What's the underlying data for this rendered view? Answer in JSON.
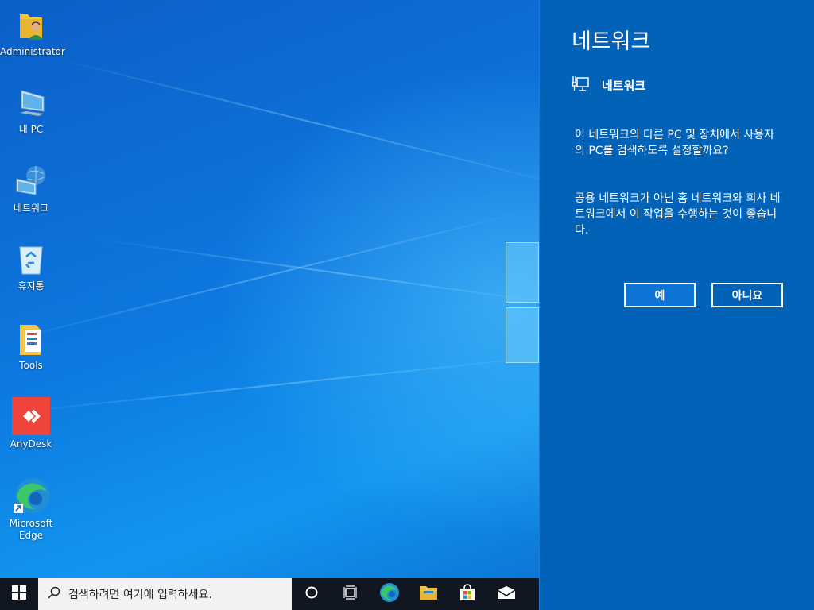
{
  "desktop": {
    "icons": [
      {
        "label": "Administrator",
        "icon": "user-folder-icon"
      },
      {
        "label": "내 PC",
        "icon": "computer-icon"
      },
      {
        "label": "네트워크",
        "icon": "network-icon"
      },
      {
        "label": "휴지통",
        "icon": "recycle-bin-icon"
      },
      {
        "label": "Tools",
        "icon": "tools-folder-icon"
      },
      {
        "label": "AnyDesk",
        "icon": "anydesk-icon"
      },
      {
        "label": "Microsoft Edge",
        "icon": "edge-icon"
      }
    ]
  },
  "panel": {
    "title": "네트워크",
    "network_name": "네트워크",
    "question": "이 네트워크의 다른 PC 및 장치에서 사용자의 PC를 검색하도록 설정할까요?",
    "advice": "공용 네트워크가 아닌 홈 네트워크와 회사 네트워크에서 이 작업을 수행하는 것이 좋습니다.",
    "yes_label": "예",
    "no_label": "아니요"
  },
  "taskbar": {
    "search_placeholder": "검색하려면 여기에 입력하세요.",
    "items": [
      "cortana-icon",
      "task-view-icon",
      "edge-icon",
      "file-explorer-icon",
      "store-icon",
      "mail-icon"
    ]
  },
  "colors": {
    "panel_bg": "#0262b8",
    "taskbar_bg": "#101720",
    "yes_button_bg": "#0b74d4"
  }
}
